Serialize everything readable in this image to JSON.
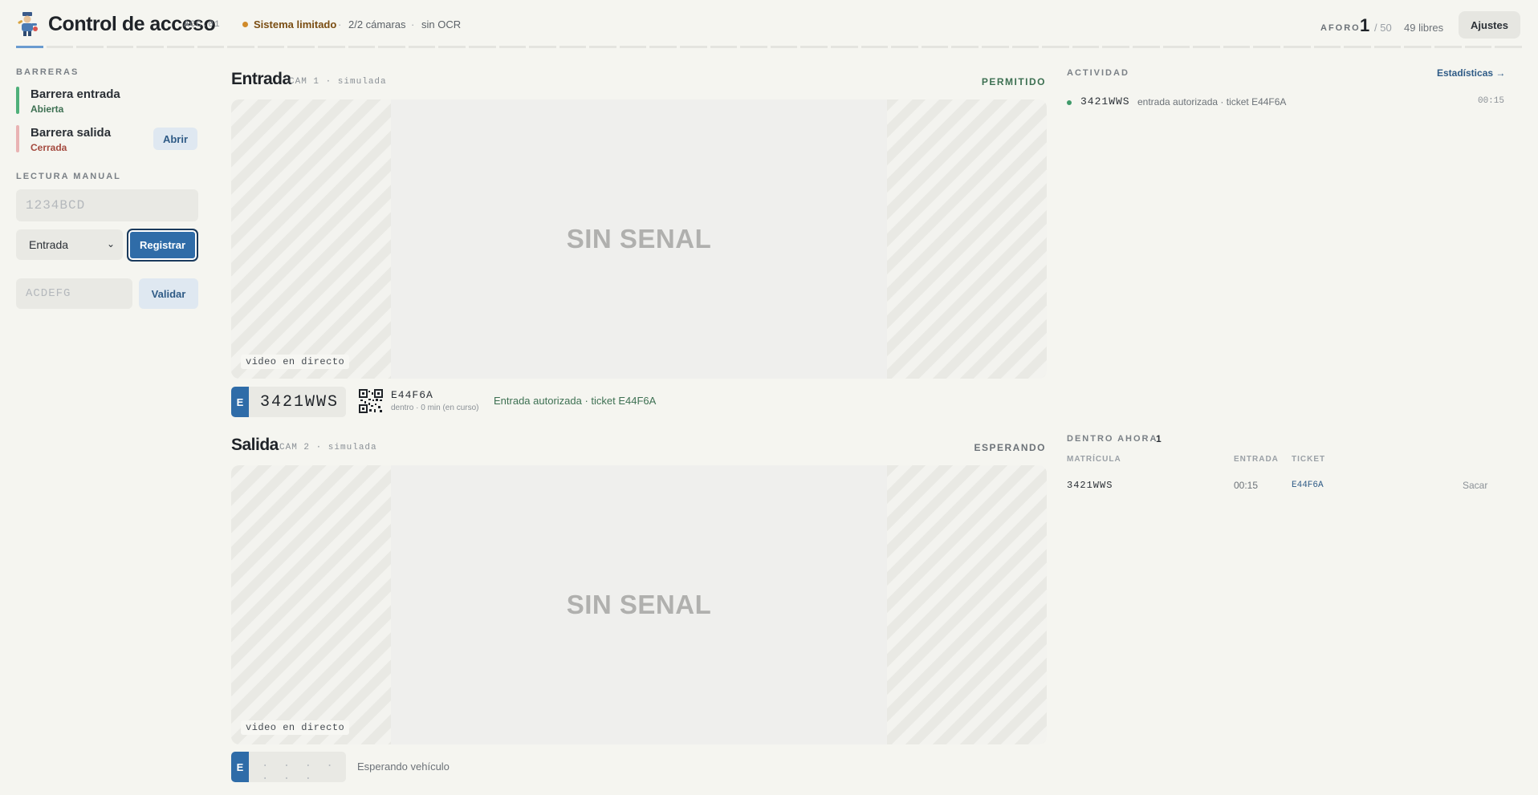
{
  "header": {
    "title": "Control de acceso",
    "code": "ACC.01",
    "status": "Sistema limitado",
    "sep": "·",
    "cameras": "2/2 cámaras",
    "ocr": "sin OCR",
    "aforo_label": "AFORO",
    "aforo_count": "1",
    "aforo_capacity": "/ 50",
    "aforo_free": "49 libres",
    "settings_label": "Ajustes",
    "status_color": "#d08a2a"
  },
  "sidebar": {
    "barriers_label": "BARRERAS",
    "barriers": [
      {
        "name": "Barrera entrada",
        "state": "Abierta",
        "color": "#4fb07a"
      },
      {
        "name": "Barrera salida",
        "state": "Cerrada",
        "color": "#e9b3b3"
      }
    ],
    "open_label": "Abrir",
    "manual_label": "LECTURA MANUAL",
    "plate_placeholder": "1234BCD",
    "direction_value": "Entrada",
    "register_label": "Registrar",
    "ticket_placeholder": "ACDEFG",
    "validate_label": "Validar"
  },
  "cameras": [
    {
      "title": "Entrada",
      "subtitle": "CAM 1 · simulada",
      "status": "PERMITIDO",
      "status_color": "#3d7052",
      "no_signal": "SIN SENAL",
      "live_label": "video en directo",
      "plate_prefix": "E",
      "plate": "3421WWS",
      "ticket_code": "E44F6A",
      "ticket_meta": "dentro · 0 min (en curso)",
      "message": "Entrada autorizada · ticket E44F6A"
    },
    {
      "title": "Salida",
      "subtitle": "CAM 2 · simulada",
      "status": "ESPERANDO",
      "status_color": "#6c7278",
      "no_signal": "SIN SENAL",
      "live_label": "video en directo",
      "plate_prefix": "E",
      "plate_placeholder": "· · · · · · ·",
      "message": "Esperando vehículo"
    }
  ],
  "activity": {
    "title": "ACTIVIDAD",
    "stats_link": "Estadísticas →",
    "items": [
      {
        "plate": "3421WWS",
        "desc": "entrada autorizada · ticket E44F6A",
        "time": "00:15"
      }
    ]
  },
  "inside": {
    "title": "DENTRO AHORA",
    "count": "1",
    "columns": [
      "MATRÍCULA",
      "ENTRADA",
      "TICKET"
    ],
    "rows": [
      {
        "plate": "3421WWS",
        "entry": "00:15",
        "ticket": "E44F6A",
        "action": "Sacar"
      }
    ]
  }
}
